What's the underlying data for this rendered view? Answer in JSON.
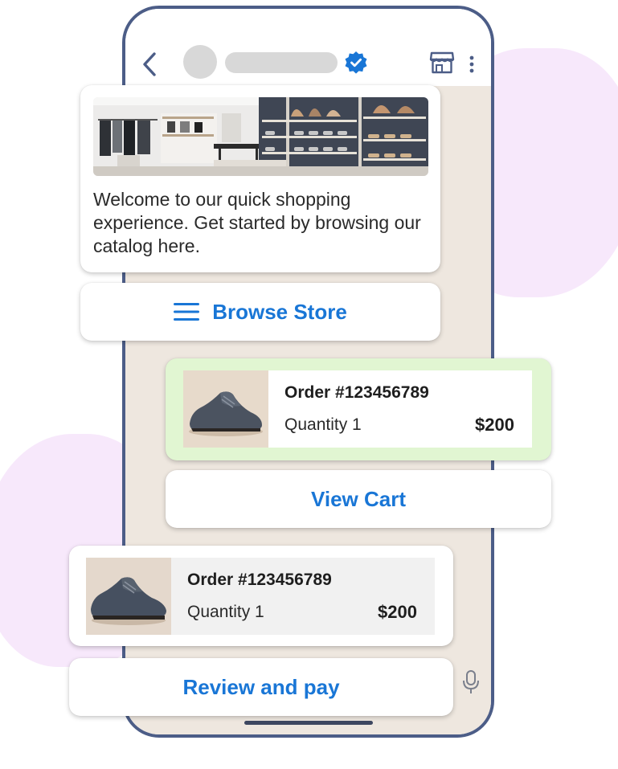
{
  "header": {
    "back_icon": "back-chevron-icon",
    "verified_icon": "verified-badge-icon",
    "store_icon": "storefront-icon",
    "more_icon": "more-vertical-icon"
  },
  "welcome": {
    "image_icon": "store-interior-photo",
    "text": "Welcome to our quick shopping experience. Get started by browsing our catalog here."
  },
  "browse": {
    "icon": "menu-lines-icon",
    "label": "Browse Store"
  },
  "order_sent": {
    "title": "Order #123456789",
    "quantity": "Quantity 1",
    "price": "$200",
    "bubble_color": "#e1f6d2"
  },
  "view_cart": {
    "label": "View Cart"
  },
  "order_received": {
    "title": "Order #123456789",
    "quantity": "Quantity 1",
    "price": "$200"
  },
  "review_pay": {
    "label": "Review and pay"
  },
  "composer": {
    "mic_icon": "microphone-icon"
  },
  "colors": {
    "accent": "#1976d6",
    "phone_frame": "#4c5d87",
    "chat_background": "#eee7df",
    "decor_blob": "#f7e8fb"
  }
}
